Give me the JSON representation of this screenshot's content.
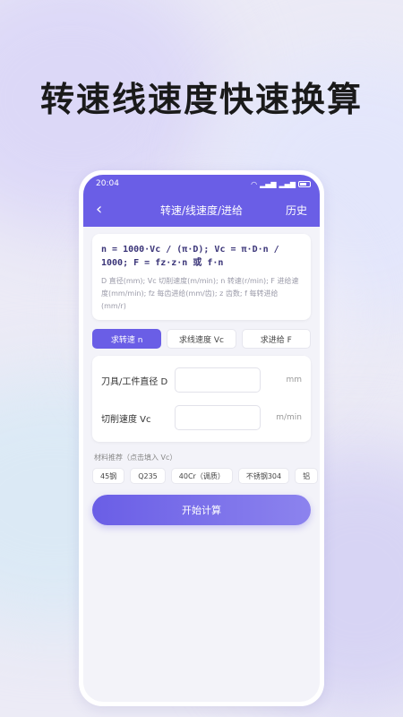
{
  "headline": "转速线速度快速换算",
  "status": {
    "time": "20:04"
  },
  "nav": {
    "back_icon": "chevron-left-icon",
    "title": "转速/线速度/进给",
    "history_label": "历史"
  },
  "formula": {
    "text": "n = 1000·Vc / (π·D); Vc = π·D·n / 1000; F = fz·z·n 或 f·n",
    "description": "D 直径(mm); Vc 切削速度(m/min); n 转速(r/min); F 进给速度(mm/min); fz 每齿进给(mm/齿); z 齿数; f 每转进给(mm/r)"
  },
  "tabs": [
    {
      "label": "求转速 n",
      "active": true
    },
    {
      "label": "求线速度 Vc",
      "active": false
    },
    {
      "label": "求进给 F",
      "active": false
    }
  ],
  "inputs": [
    {
      "label": "刀具/工件直径 D",
      "value": "",
      "unit": "mm"
    },
    {
      "label": "切削速度 Vc",
      "value": "",
      "unit": "m/min"
    }
  ],
  "materials": {
    "title": "材料推荐（点击填入 Vc）",
    "items": [
      "45钢",
      "Q235",
      "40Cr（调质）",
      "不锈钢304",
      "铝"
    ]
  },
  "calc_button": "开始计算",
  "colors": {
    "accent": "#6a5ee6"
  }
}
